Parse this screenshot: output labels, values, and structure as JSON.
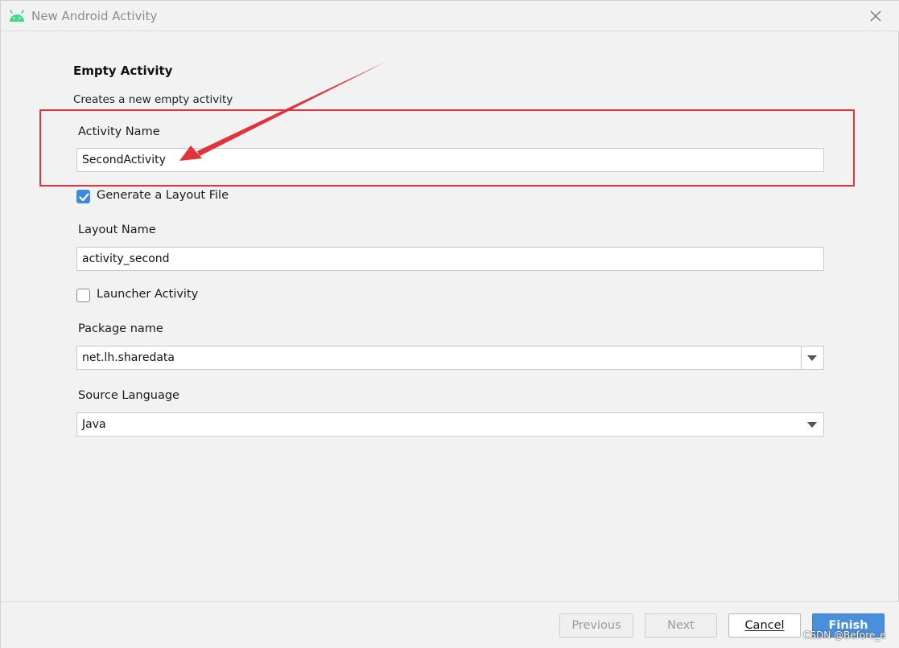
{
  "window": {
    "title": "New Android Activity",
    "app_icon": "android-icon",
    "close_icon": "close-icon"
  },
  "form": {
    "heading": "Empty Activity",
    "description": "Creates a new empty activity",
    "activity_name": {
      "label": "Activity Name",
      "value": "SecondActivity"
    },
    "generate_layout": {
      "label": "Generate a Layout File",
      "checked": true
    },
    "layout_name": {
      "label": "Layout Name",
      "value": "activity_second"
    },
    "launcher_activity": {
      "label": "Launcher Activity",
      "checked": false
    },
    "package_name": {
      "label": "Package name",
      "value": "net.lh.sharedata"
    },
    "source_language": {
      "label": "Source Language",
      "value": "Java"
    }
  },
  "footer": {
    "previous_label": "Previous",
    "next_label": "Next",
    "cancel_label": "Cancel",
    "finish_label": "Finish"
  },
  "annotation": {
    "color": "#e0333a"
  },
  "watermark": "CSDN @Before_e",
  "colors": {
    "accent": "#4a8fdc",
    "android_green": "#3ddc84"
  }
}
